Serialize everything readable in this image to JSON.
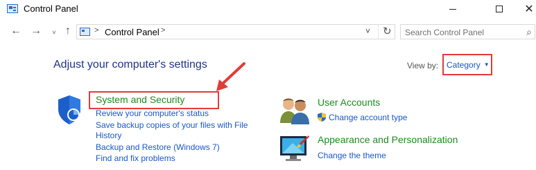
{
  "window": {
    "title": "Control Panel",
    "minimize_glyph": "—",
    "maximize_glyph": "□",
    "close_glyph": "✕"
  },
  "nav": {
    "back_glyph": "←",
    "forward_glyph": "→",
    "recent_glyph": "˅",
    "up_glyph": "↑"
  },
  "address": {
    "separator": ">",
    "path": "Control Panel",
    "dropdown_glyph": "˅",
    "refresh_glyph": "↻"
  },
  "search": {
    "placeholder": "Search Control Panel",
    "icon_glyph": "⌕"
  },
  "main": {
    "heading": "Adjust your computer's settings",
    "view_by_label": "View by:",
    "view_by_value": "Category",
    "caret_glyph": "▼"
  },
  "categories": {
    "system_security": {
      "title": "System and Security",
      "links": [
        "Review your computer's status",
        "Save backup copies of your files with File",
        "History",
        "Backup and Restore (Windows 7)",
        "Find and fix problems"
      ]
    },
    "user_accounts": {
      "title": "User Accounts",
      "links": [
        "Change account type"
      ]
    },
    "appearance": {
      "title": "Appearance and Personalization",
      "links": [
        "Change the theme"
      ]
    }
  },
  "colors": {
    "link": "#1a56c6",
    "category_title": "#1e8a1e",
    "heading": "#1e3287",
    "highlight_box": "#e13b3b"
  }
}
